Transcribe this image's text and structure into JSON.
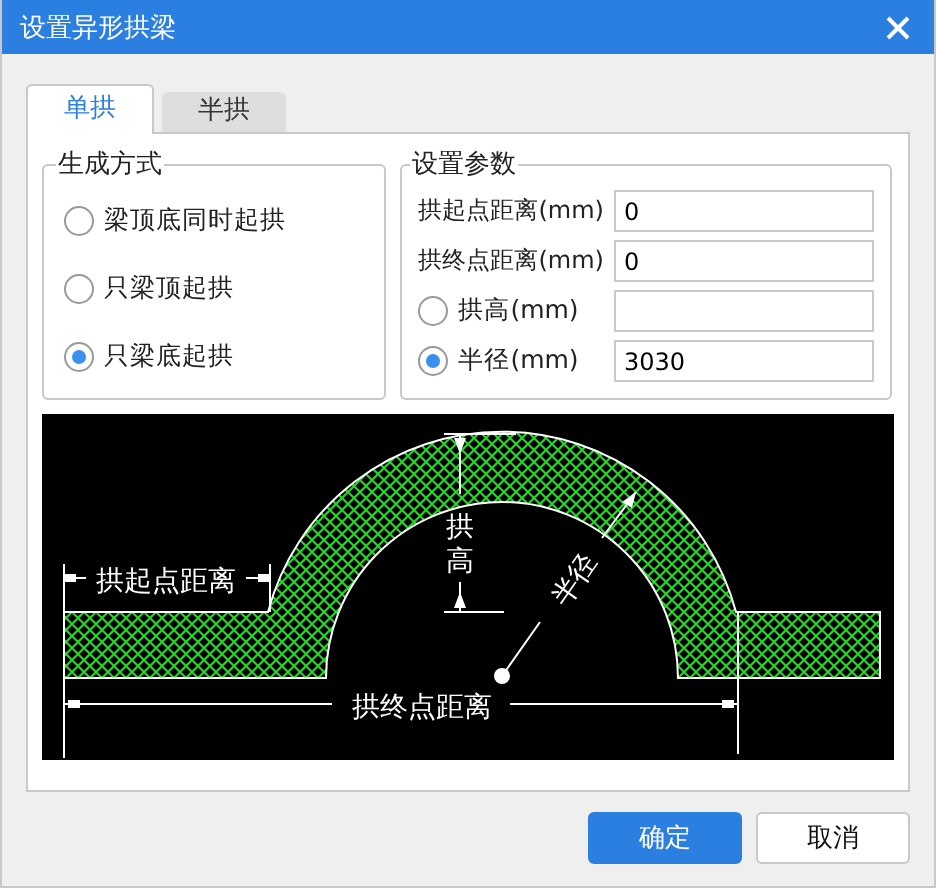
{
  "window": {
    "title": "设置异形拱梁"
  },
  "tabs": [
    {
      "label": "单拱",
      "selected": true
    },
    {
      "label": "半拱",
      "selected": false
    }
  ],
  "generation_mode": {
    "title": "生成方式",
    "options": [
      {
        "label": "梁顶底同时起拱",
        "selected": false
      },
      {
        "label": "只梁顶起拱",
        "selected": false
      },
      {
        "label": "只梁底起拱",
        "selected": true
      }
    ]
  },
  "parameters": {
    "title": "设置参数",
    "fields": [
      {
        "kind": "text",
        "label": "拱起点距离(mm)",
        "value": "0"
      },
      {
        "kind": "text",
        "label": "拱终点距离(mm)",
        "value": "0"
      },
      {
        "kind": "radio",
        "label": "拱高(mm)",
        "selected": false
      },
      {
        "kind": "radio",
        "label": "半径(mm)",
        "selected": true,
        "value": "3030"
      }
    ]
  },
  "diagram": {
    "start_label": "拱起点距离",
    "end_label": "拱终点距离",
    "height_label": "拱高",
    "radius_label": "半径"
  },
  "buttons": [
    {
      "label": "确定",
      "kind": "primary"
    },
    {
      "label": "取消",
      "kind": "default"
    }
  ]
}
